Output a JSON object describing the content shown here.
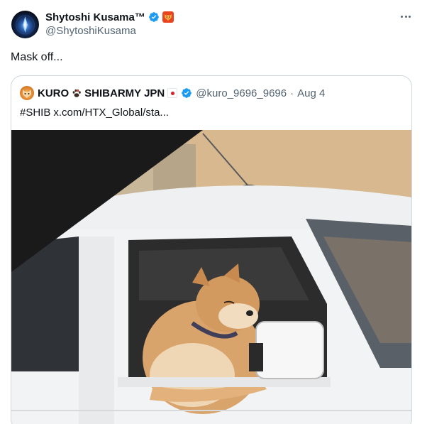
{
  "author": {
    "display_name": "Shytoshi Kusama™",
    "handle": "@ShytoshiKusama",
    "verified": true
  },
  "tweet": {
    "text": "Mask off..."
  },
  "quoted_tweet": {
    "display_name_prefix": "KURO",
    "display_name_suffix": "SHIBARMY JPN",
    "handle": "@kuro_9696_9696",
    "separator": "·",
    "date": "Aug 4",
    "hashtag": "#SHIB",
    "link": "x.com/HTX_Global/sta..."
  },
  "icons": {
    "verified": "verified-badge-icon",
    "affiliate": "shiba-affiliate-badge",
    "more": "more-options-icon",
    "paw": "paw-icon",
    "flag": "japan-flag"
  },
  "colors": {
    "verified_blue": "#1d9bf0",
    "secondary_text": "#536471",
    "border": "#cfd9de",
    "affiliate_badge": "#e8441f"
  }
}
